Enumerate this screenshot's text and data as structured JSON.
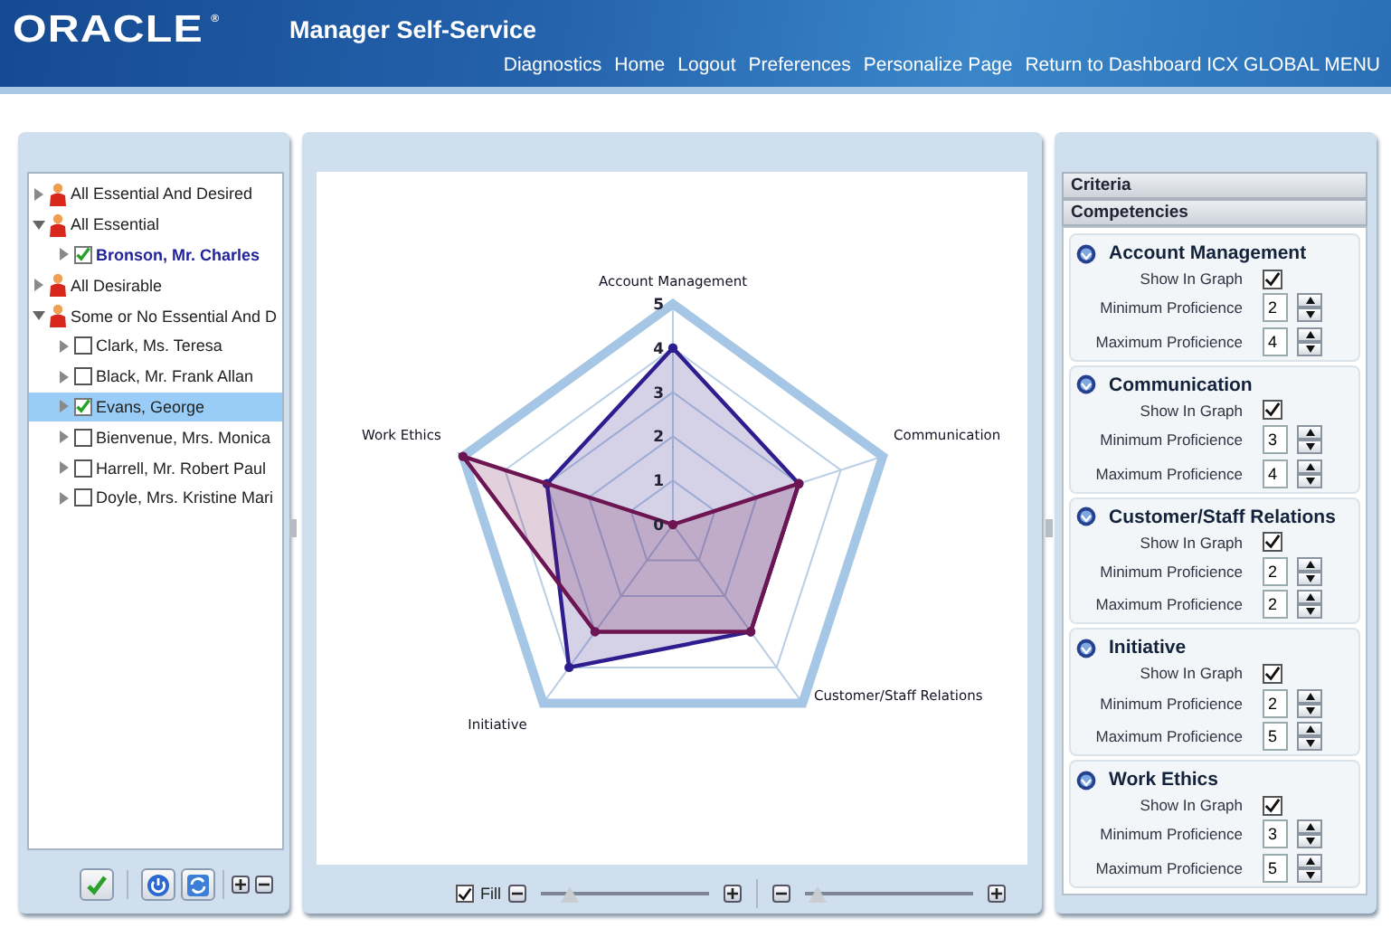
{
  "header": {
    "logo": "ORACLE",
    "logo_mark": "®",
    "title": "Manager Self-Service",
    "links": [
      "Diagnostics",
      "Home",
      "Logout",
      "Preferences",
      "Personalize Page",
      "Return to Dashboard ICX GLOBAL MENU"
    ]
  },
  "tree": [
    {
      "kind": "group",
      "label": "All Essential And Desired",
      "expanded": false
    },
    {
      "kind": "group",
      "label": "All Essential",
      "expanded": true,
      "children": [
        {
          "kind": "person",
          "label": "Bronson, Mr. Charles",
          "checked": true,
          "selected": false,
          "emphasized": true
        }
      ]
    },
    {
      "kind": "group",
      "label": "All Desirable",
      "expanded": false
    },
    {
      "kind": "group",
      "label": "Some or No Essential And D",
      "expanded": true,
      "children": [
        {
          "kind": "person",
          "label": "Clark, Ms. Teresa",
          "checked": false,
          "selected": false,
          "emphasized": false
        },
        {
          "kind": "person",
          "label": "Black, Mr. Frank Allan",
          "checked": false,
          "selected": false,
          "emphasized": false
        },
        {
          "kind": "person",
          "label": "Evans, George",
          "checked": true,
          "selected": true,
          "emphasized": false
        },
        {
          "kind": "person",
          "label": "Bienvenue, Mrs. Monica",
          "checked": false,
          "selected": false,
          "emphasized": false
        },
        {
          "kind": "person",
          "label": "Harrell, Mr. Robert Paul",
          "checked": false,
          "selected": false,
          "emphasized": false
        },
        {
          "kind": "person",
          "label": "Doyle, Mrs. Kristine Mari",
          "checked": false,
          "selected": false,
          "emphasized": false
        }
      ]
    }
  ],
  "chart": {
    "radar": {
      "axes": [
        "Account Management",
        "Communication",
        "Customer/Staff Relations",
        "Initiative",
        "Work Ethics"
      ],
      "scale_labels": [
        "5",
        "4",
        "3",
        "2",
        "1",
        "0"
      ],
      "series": [
        {
          "color": "#2e1d8e"
        },
        {
          "color": "#6c1552"
        }
      ]
    },
    "controls": {
      "fill": {
        "label": "Fill",
        "checked": true
      },
      "sliders": [
        {
          "level": 0.17
        },
        {
          "level": 0.08
        }
      ]
    }
  },
  "criteria": {
    "sections": [
      "Criteria",
      "Competencies"
    ],
    "competencies": [
      {
        "name": "Account Management",
        "show_label": "Show In Graph",
        "show_in_graph": true,
        "min_label": "Minimum Proficience",
        "min": "2",
        "max_label": "Maximum Proficience",
        "max": "4"
      },
      {
        "name": "Communication",
        "show_label": "Show In Graph",
        "show_in_graph": true,
        "min_label": "Minimum Proficience",
        "min": "3",
        "max_label": "Maximum Proficience",
        "max": "4"
      },
      {
        "name": "Customer/Staff Relations",
        "show_label": "Show In Graph",
        "show_in_graph": true,
        "min_label": "Minimum Proficience",
        "min": "2",
        "max_label": "Maximum Proficience",
        "max": "2"
      },
      {
        "name": "Initiative",
        "show_label": "Show In Graph",
        "show_in_graph": true,
        "min_label": "Minimum Proficience",
        "min": "2",
        "max_label": "Maximum Proficience",
        "max": "5"
      },
      {
        "name": "Work Ethics",
        "show_label": "Show In Graph",
        "show_in_graph": true,
        "min_label": "Minimum Proficience",
        "min": "3",
        "max_label": "Maximum Proficience",
        "max": "5"
      }
    ]
  }
}
